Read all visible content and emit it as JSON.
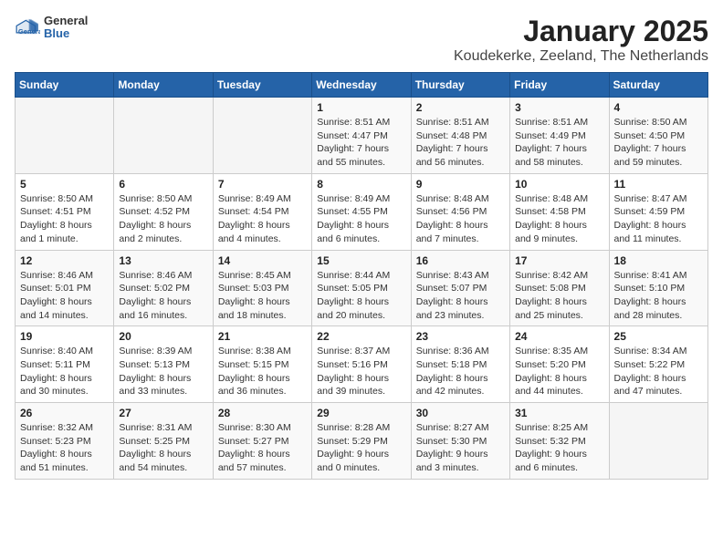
{
  "header": {
    "logo_general": "General",
    "logo_blue": "Blue",
    "title": "January 2025",
    "subtitle": "Koudekerke, Zeeland, The Netherlands"
  },
  "weekdays": [
    "Sunday",
    "Monday",
    "Tuesday",
    "Wednesday",
    "Thursday",
    "Friday",
    "Saturday"
  ],
  "weeks": [
    [
      {
        "day": "",
        "content": ""
      },
      {
        "day": "",
        "content": ""
      },
      {
        "day": "",
        "content": ""
      },
      {
        "day": "1",
        "content": "Sunrise: 8:51 AM\nSunset: 4:47 PM\nDaylight: 7 hours\nand 55 minutes."
      },
      {
        "day": "2",
        "content": "Sunrise: 8:51 AM\nSunset: 4:48 PM\nDaylight: 7 hours\nand 56 minutes."
      },
      {
        "day": "3",
        "content": "Sunrise: 8:51 AM\nSunset: 4:49 PM\nDaylight: 7 hours\nand 58 minutes."
      },
      {
        "day": "4",
        "content": "Sunrise: 8:50 AM\nSunset: 4:50 PM\nDaylight: 7 hours\nand 59 minutes."
      }
    ],
    [
      {
        "day": "5",
        "content": "Sunrise: 8:50 AM\nSunset: 4:51 PM\nDaylight: 8 hours\nand 1 minute."
      },
      {
        "day": "6",
        "content": "Sunrise: 8:50 AM\nSunset: 4:52 PM\nDaylight: 8 hours\nand 2 minutes."
      },
      {
        "day": "7",
        "content": "Sunrise: 8:49 AM\nSunset: 4:54 PM\nDaylight: 8 hours\nand 4 minutes."
      },
      {
        "day": "8",
        "content": "Sunrise: 8:49 AM\nSunset: 4:55 PM\nDaylight: 8 hours\nand 6 minutes."
      },
      {
        "day": "9",
        "content": "Sunrise: 8:48 AM\nSunset: 4:56 PM\nDaylight: 8 hours\nand 7 minutes."
      },
      {
        "day": "10",
        "content": "Sunrise: 8:48 AM\nSunset: 4:58 PM\nDaylight: 8 hours\nand 9 minutes."
      },
      {
        "day": "11",
        "content": "Sunrise: 8:47 AM\nSunset: 4:59 PM\nDaylight: 8 hours\nand 11 minutes."
      }
    ],
    [
      {
        "day": "12",
        "content": "Sunrise: 8:46 AM\nSunset: 5:01 PM\nDaylight: 8 hours\nand 14 minutes."
      },
      {
        "day": "13",
        "content": "Sunrise: 8:46 AM\nSunset: 5:02 PM\nDaylight: 8 hours\nand 16 minutes."
      },
      {
        "day": "14",
        "content": "Sunrise: 8:45 AM\nSunset: 5:03 PM\nDaylight: 8 hours\nand 18 minutes."
      },
      {
        "day": "15",
        "content": "Sunrise: 8:44 AM\nSunset: 5:05 PM\nDaylight: 8 hours\nand 20 minutes."
      },
      {
        "day": "16",
        "content": "Sunrise: 8:43 AM\nSunset: 5:07 PM\nDaylight: 8 hours\nand 23 minutes."
      },
      {
        "day": "17",
        "content": "Sunrise: 8:42 AM\nSunset: 5:08 PM\nDaylight: 8 hours\nand 25 minutes."
      },
      {
        "day": "18",
        "content": "Sunrise: 8:41 AM\nSunset: 5:10 PM\nDaylight: 8 hours\nand 28 minutes."
      }
    ],
    [
      {
        "day": "19",
        "content": "Sunrise: 8:40 AM\nSunset: 5:11 PM\nDaylight: 8 hours\nand 30 minutes."
      },
      {
        "day": "20",
        "content": "Sunrise: 8:39 AM\nSunset: 5:13 PM\nDaylight: 8 hours\nand 33 minutes."
      },
      {
        "day": "21",
        "content": "Sunrise: 8:38 AM\nSunset: 5:15 PM\nDaylight: 8 hours\nand 36 minutes."
      },
      {
        "day": "22",
        "content": "Sunrise: 8:37 AM\nSunset: 5:16 PM\nDaylight: 8 hours\nand 39 minutes."
      },
      {
        "day": "23",
        "content": "Sunrise: 8:36 AM\nSunset: 5:18 PM\nDaylight: 8 hours\nand 42 minutes."
      },
      {
        "day": "24",
        "content": "Sunrise: 8:35 AM\nSunset: 5:20 PM\nDaylight: 8 hours\nand 44 minutes."
      },
      {
        "day": "25",
        "content": "Sunrise: 8:34 AM\nSunset: 5:22 PM\nDaylight: 8 hours\nand 47 minutes."
      }
    ],
    [
      {
        "day": "26",
        "content": "Sunrise: 8:32 AM\nSunset: 5:23 PM\nDaylight: 8 hours\nand 51 minutes."
      },
      {
        "day": "27",
        "content": "Sunrise: 8:31 AM\nSunset: 5:25 PM\nDaylight: 8 hours\nand 54 minutes."
      },
      {
        "day": "28",
        "content": "Sunrise: 8:30 AM\nSunset: 5:27 PM\nDaylight: 8 hours\nand 57 minutes."
      },
      {
        "day": "29",
        "content": "Sunrise: 8:28 AM\nSunset: 5:29 PM\nDaylight: 9 hours\nand 0 minutes."
      },
      {
        "day": "30",
        "content": "Sunrise: 8:27 AM\nSunset: 5:30 PM\nDaylight: 9 hours\nand 3 minutes."
      },
      {
        "day": "31",
        "content": "Sunrise: 8:25 AM\nSunset: 5:32 PM\nDaylight: 9 hours\nand 6 minutes."
      },
      {
        "day": "",
        "content": ""
      }
    ]
  ]
}
